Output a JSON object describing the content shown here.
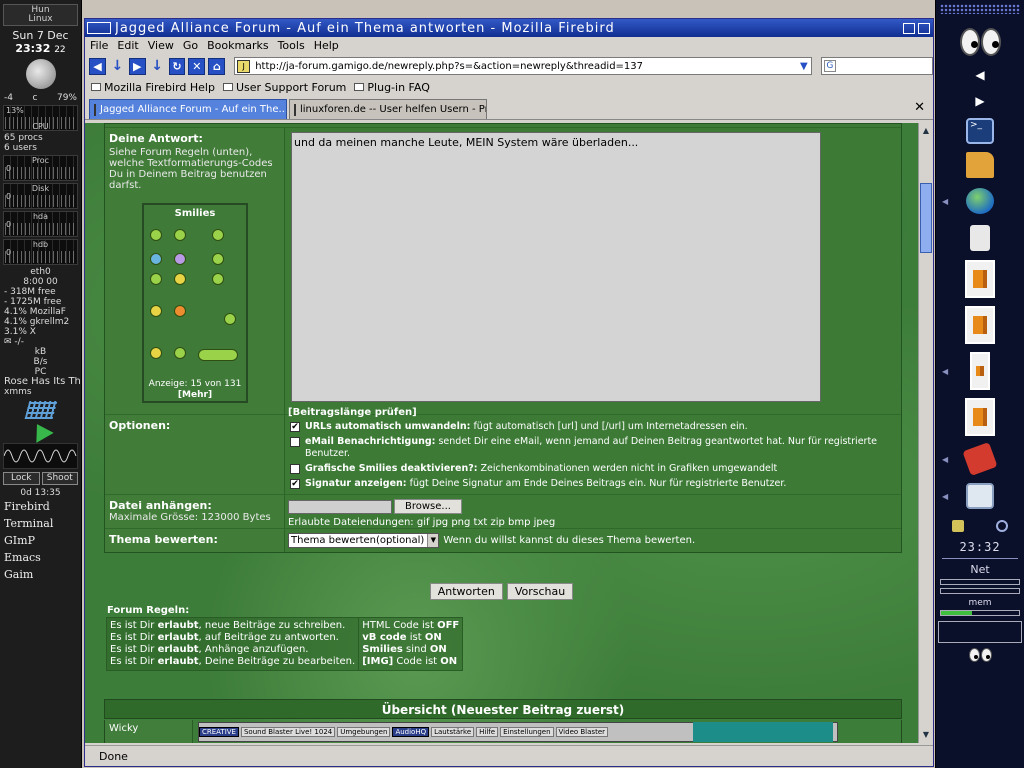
{
  "left_panel": {
    "hostname": "Hun",
    "os": "Linux",
    "date": "Sun 7 Dec",
    "time": "23:32",
    "seconds": "22",
    "temp": "-4",
    "temp_unit": "c",
    "humidity": "79%",
    "cpu_percent": "13%",
    "cpu_label": "CPU",
    "procs": "65 procs",
    "users": "6 users",
    "proc_label": "Proc",
    "disk_label": "Disk",
    "hda_label": "hda",
    "hdb_label": "hdb",
    "eth_label": "eth0",
    "zero": "0",
    "uptime": "8:00 00",
    "mem_free": "- 318M free",
    "swap_free": "- 1725M free",
    "top_procs": [
      "4.1% MozillaF",
      "4.1% gkrellm2",
      "3.1% X"
    ],
    "mail_label": "-/-",
    "speed_items": [
      "kB",
      "B/s",
      "PC"
    ],
    "song": "Rose Has Its Thorn",
    "xmms": "xmms",
    "lock_label": "Lock",
    "shoot_label": "Shoot",
    "elapsed": "0d 13:35",
    "launchers": [
      "Firebird",
      "Terminal",
      "GImP",
      "Emacs",
      "Gaim"
    ]
  },
  "window": {
    "title": "Jagged Alliance Forum - Auf ein Thema antworten - Mozilla Firebird"
  },
  "menu": [
    "File",
    "Edit",
    "View",
    "Go",
    "Bookmarks",
    "Tools",
    "Help"
  ],
  "url": "http://ja-forum.gamigo.de/newreply.php?s=&action=newreply&threadid=137",
  "search": {
    "value": ""
  },
  "bookmarks": [
    "Mozilla Firebird Help",
    "User Support Forum",
    "Plug-in FAQ"
  ],
  "tabs": [
    {
      "label": "Jagged Alliance Forum - Auf ein The..."
    },
    {
      "label": "linuxforen.de -- User helfen Usern - Pr..."
    }
  ],
  "form": {
    "answer_label": "Deine Antwort:",
    "answer_help": "Siehe Forum Regeln (unten), welche Textformatierungs-Codes Du in Deinem Beitrag benutzen darfst.",
    "smilies_title": "Smilies",
    "smilies_count": "Anzeige: 15 von 131",
    "smilies_more": "[Mehr]",
    "message_text": "und da meinen manche Leute, MEIN System wäre überladen...",
    "check_length": "[Beitragslänge prüfen]",
    "options_label": "Optionen:",
    "options": [
      {
        "checked": true,
        "bold": "URLs automatisch umwandeln:",
        "text": " fügt automatisch [url] und [/url] um Internetadressen ein."
      },
      {
        "checked": false,
        "bold": "eMail Benachrichtigung:",
        "text": " sendet Dir eine eMail, wenn jemand auf Deinen Beitrag geantwortet hat. Nur für registrierte Benutzer."
      },
      {
        "checked": false,
        "bold": "Grafische Smilies deaktivieren?:",
        "text": " Zeichenkombinationen werden nicht in Grafiken umgewandelt"
      },
      {
        "checked": true,
        "bold": "Signatur anzeigen:",
        "text": " fügt Deine Signatur am Ende Deines Beitrags ein. Nur für registrierte Benutzer."
      }
    ],
    "attach_label": "Datei anhängen:",
    "attach_max": "Maximale Grösse: 123000 Bytes",
    "browse_label": "Browse...",
    "attach_types": "Erlaubte Dateiendungen: gif jpg png txt zip bmp jpeg",
    "rate_label": "Thema bewerten:",
    "rate_select": "Thema bewerten(optional)",
    "rate_help": "Wenn du willst kannst du dieses Thema bewerten.",
    "submit_label": "Antworten",
    "preview_label": "Vorschau"
  },
  "rules": {
    "title": "Forum Regeln:",
    "left": [
      [
        "Es ist Dir ",
        "erlaubt",
        ", neue Beiträge zu schreiben."
      ],
      [
        "Es ist Dir ",
        "erlaubt",
        ", auf Beiträge zu antworten."
      ],
      [
        "Es ist Dir ",
        "erlaubt",
        ", Anhänge anzufügen."
      ],
      [
        "Es ist Dir ",
        "erlaubt",
        ", Deine Beiträge zu bearbeiten."
      ]
    ],
    "right": [
      [
        "HTML Code ist ",
        "OFF"
      ],
      [
        "vB code",
        " ist ",
        "ON"
      ],
      [
        "Smilies",
        " sind ",
        "ON"
      ],
      [
        "[IMG]",
        " Code ist ",
        "ON"
      ]
    ]
  },
  "overview": {
    "title": "Übersicht (Neuester Beitrag zuerst)",
    "author": "Wicky",
    "strip_items": [
      "CREATIVE",
      "Sound Blaster Live! 1024",
      "Umgebungen",
      "AudioHQ",
      "Lautstärke",
      "Hilfe",
      "Einstellungen",
      "Video Blaster"
    ]
  },
  "status": "Done",
  "right_dock": {
    "time": "23:32",
    "net_label": "Net",
    "mem_label": "mem",
    "mem_usage": 0.4
  }
}
